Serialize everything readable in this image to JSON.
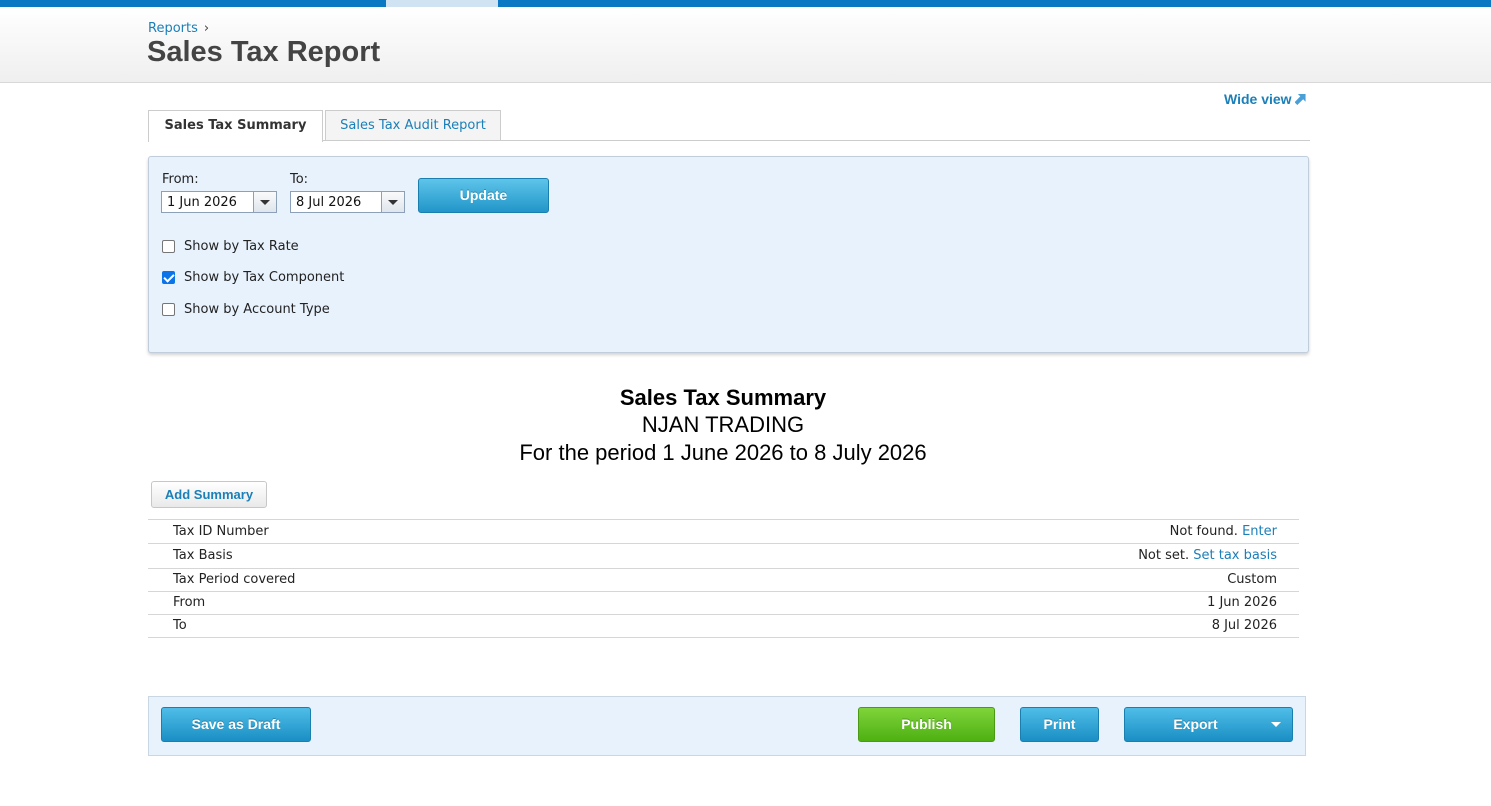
{
  "header": {
    "breadcrumb": "Reports",
    "breadcrumb_sep": "›",
    "title": "Sales Tax Report",
    "wide_view": "Wide view"
  },
  "tabs": [
    {
      "label": "Sales Tax Summary",
      "active": true
    },
    {
      "label": "Sales Tax Audit Report",
      "active": false
    }
  ],
  "filters": {
    "from_label": "From:",
    "from_value": "1 Jun 2026",
    "to_label": "To:",
    "to_value": "8 Jul 2026",
    "update_label": "Update",
    "options": [
      {
        "label": "Show by Tax Rate",
        "checked": false
      },
      {
        "label": "Show by Tax Component",
        "checked": true
      },
      {
        "label": "Show by Account Type",
        "checked": false
      }
    ]
  },
  "report": {
    "title": "Sales Tax Summary",
    "company": "NJAN TRADING",
    "period": "For the period 1 June 2026 to 8 July 2026",
    "add_summary": "Add Summary",
    "rows": [
      {
        "key": "Tax ID Number",
        "value": "Not found.",
        "link": "Enter"
      },
      {
        "key": "Tax Basis",
        "value": "Not set.",
        "link": "Set tax basis"
      },
      {
        "key": "Tax Period covered",
        "value": "Custom",
        "link": ""
      },
      {
        "key": "From",
        "value": "1 Jun 2026",
        "link": ""
      },
      {
        "key": "To",
        "value": "8 Jul 2026",
        "link": ""
      }
    ]
  },
  "footer": {
    "save_draft": "Save as Draft",
    "publish": "Publish",
    "print": "Print",
    "export": "Export"
  },
  "colors": {
    "brand_blue": "#0b78c3",
    "link": "#1b7fb8",
    "publish_green": "#4eb012"
  }
}
